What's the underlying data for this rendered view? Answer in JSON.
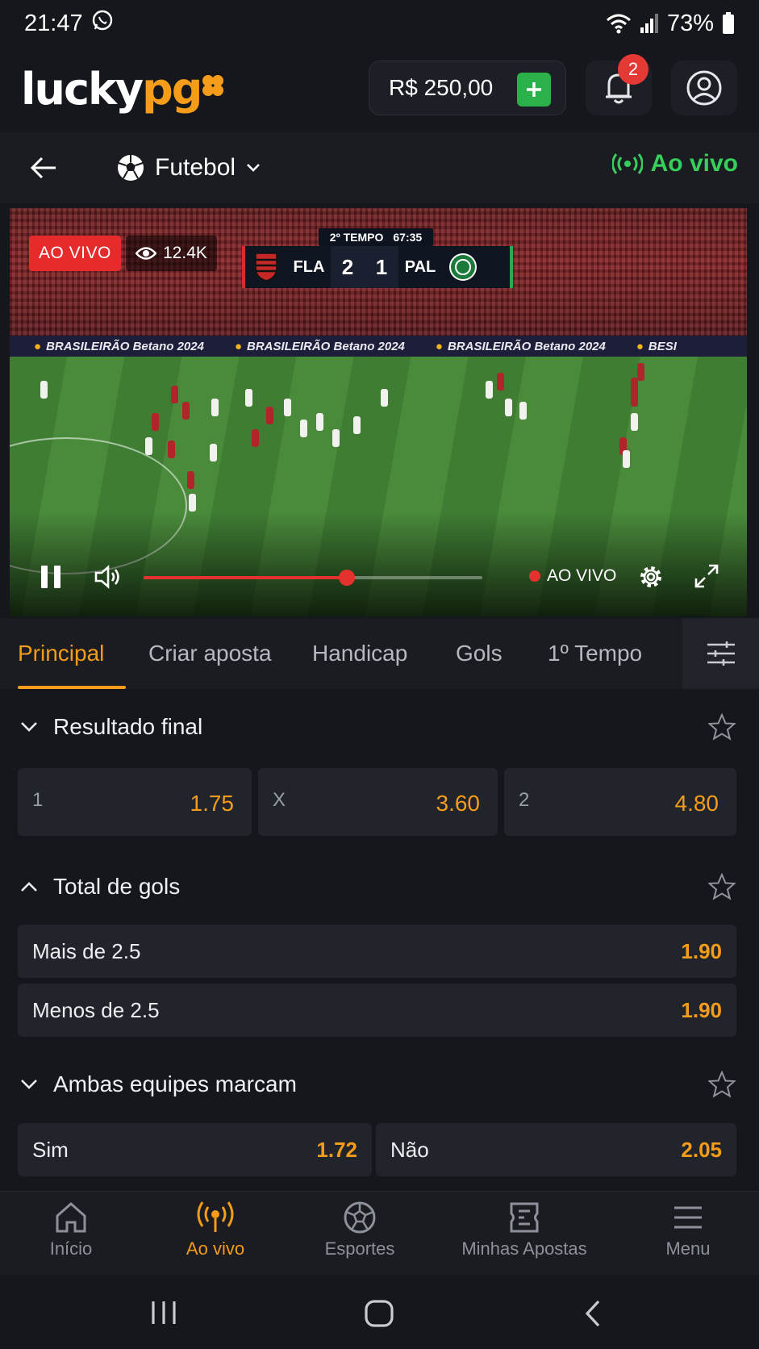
{
  "status": {
    "time": "21:47",
    "battery": "73%"
  },
  "header": {
    "logo_main": "lucky",
    "logo_accent": "pg",
    "balance": "R$ 250,00",
    "notifications_count": "2",
    "accent_color": "#f59c1a"
  },
  "subnav": {
    "sport": "Futebol",
    "live_label": "Ao vivo"
  },
  "video": {
    "live_badge": "AO VIVO",
    "viewers": "12.4K",
    "period": "2º TEMPO",
    "clock": "67:35",
    "home_team": "FLA",
    "away_team": "PAL",
    "home_score": "2",
    "away_score": "1",
    "ad_text": "BRASILEIRÃO Betano 2024",
    "ad_cut": "BESI",
    "progress": 0.6,
    "live_control": "AO VIVO"
  },
  "tabs": [
    "Principal",
    "Criar aposta",
    "Handicap",
    "Gols",
    "1º Tempo"
  ],
  "markets": {
    "resultado": {
      "title": "Resultado final",
      "odds": [
        {
          "label": "1",
          "value": "1.75"
        },
        {
          "label": "X",
          "value": "3.60"
        },
        {
          "label": "2",
          "value": "4.80"
        }
      ]
    },
    "total": {
      "title": "Total de gols",
      "rows": [
        {
          "label": "Mais de 2.5",
          "value": "1.90"
        },
        {
          "label": "Menos de 2.5",
          "value": "1.90"
        }
      ]
    },
    "ambas": {
      "title": "Ambas equipes marcam",
      "options": [
        {
          "label": "Sim",
          "value": "1.72"
        },
        {
          "label": "Não",
          "value": "2.05"
        }
      ]
    }
  },
  "bottom_nav": {
    "inicio": "Início",
    "ao_vivo": "Ao vivo",
    "esportes": "Esportes",
    "minhas_apostas": "Minhas Apostas",
    "menu": "Menu"
  }
}
